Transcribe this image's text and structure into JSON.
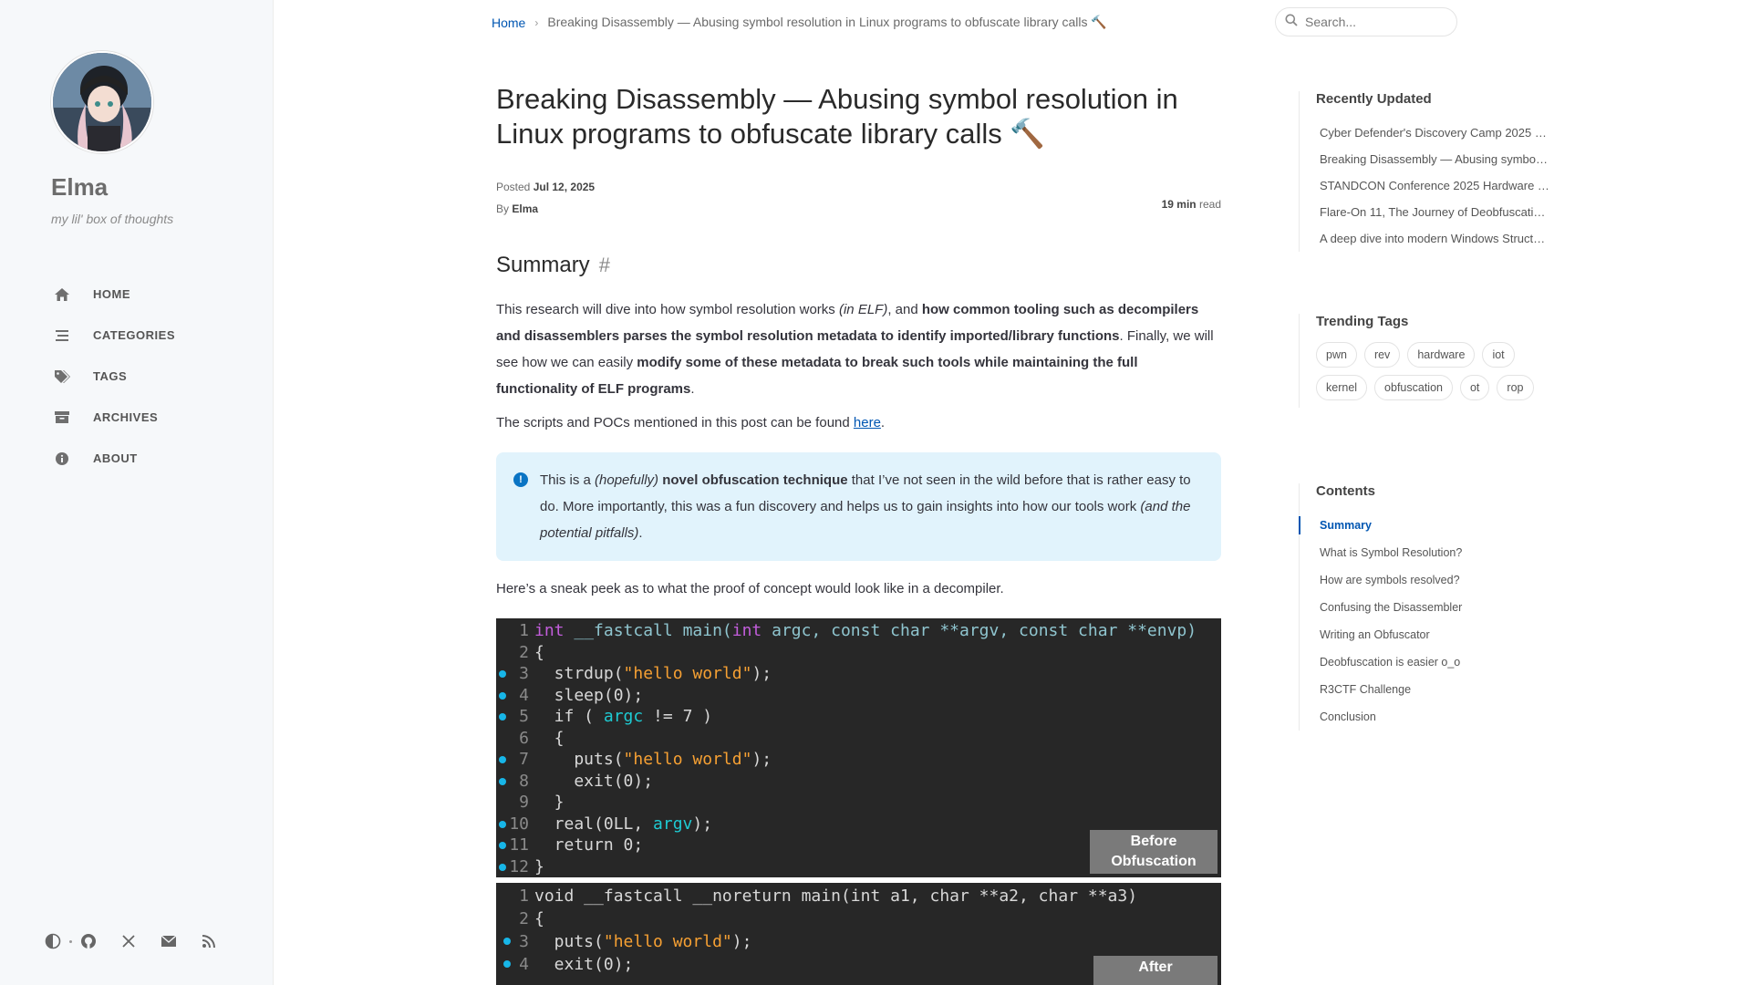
{
  "sidebar": {
    "site_title": "Elma",
    "site_subtitle": "my lil' box of thoughts",
    "nav": [
      {
        "label": "HOME",
        "icon": "home-icon"
      },
      {
        "label": "CATEGORIES",
        "icon": "stream-icon"
      },
      {
        "label": "TAGS",
        "icon": "tags-icon"
      },
      {
        "label": "ARCHIVES",
        "icon": "archive-icon"
      },
      {
        "label": "ABOUT",
        "icon": "info-icon"
      }
    ],
    "bottom_icons": [
      "theme-toggle-icon",
      "github-icon",
      "x-twitter-icon",
      "email-icon",
      "rss-icon"
    ]
  },
  "topbar": {
    "breadcrumb_home": "Home",
    "breadcrumb_current": "Breaking Disassembly — Abusing symbol resolution in Linux programs to obfuscate library calls 🔨",
    "search_placeholder": "Search..."
  },
  "post": {
    "title": "Breaking Disassembly — Abusing symbol resolution in Linux programs to obfuscate library calls 🔨",
    "posted_label": "Posted",
    "date": "Jul 12, 2025",
    "by_label": "By",
    "author": "Elma",
    "read_minutes": "19 min",
    "read_label": "read",
    "section_title": "Summary",
    "para1": {
      "a": "This research will dive into how symbol resolution works ",
      "b": "(in ELF)",
      "c": ", and ",
      "d": "how common tooling such as decompilers and disassemblers parses the symbol resolution metadata to identify imported/library functions",
      "e": ". Finally, we will see how we can easily ",
      "f": "modify some of these metadata to break such tools while maintaining the full functionality of ELF programs",
      "g": "."
    },
    "para2": {
      "a": "The scripts and POCs mentioned in this post can be found ",
      "link": "here",
      "b": "."
    },
    "note": {
      "a": "This is a ",
      "b": "(hopefully)",
      "c": " ",
      "d": "novel obfuscation technique",
      "e": " that I’ve not seen in the wild before that is rather easy to do. More importantly, this was a fun discovery and helps us to gain insights into how our tools work ",
      "f": "(and the potential pitfalls)",
      "g": "."
    },
    "para3": "Here’s a sneak peek as to what the proof of concept would look like in a decompiler.",
    "code_before_tag": "Before Obfuscation",
    "code_after_tag": "After"
  },
  "right_panel": {
    "recent_title": "Recently Updated",
    "recent": [
      "Cyber Defender's Discovery Camp 2025 …",
      "Breaking Disassembly — Abusing symbo…",
      "STANDCON Conference 2025 Hardware B…",
      "Flare-On 11, The Journey of Deobfuscati…",
      "A deep dive into modern Windows Struct…"
    ],
    "tags_title": "Trending Tags",
    "tags": [
      "pwn",
      "rev",
      "hardware",
      "iot",
      "kernel",
      "obfuscation",
      "ot",
      "rop"
    ],
    "toc_title": "Contents",
    "toc": [
      "Summary",
      "What is Symbol Resolution?",
      "How are symbols resolved?",
      "Confusing the Disassembler",
      "Writing an Obfuscator",
      "Deobfuscation is easier o_o",
      "R3CTF Challenge",
      "Conclusion"
    ]
  }
}
